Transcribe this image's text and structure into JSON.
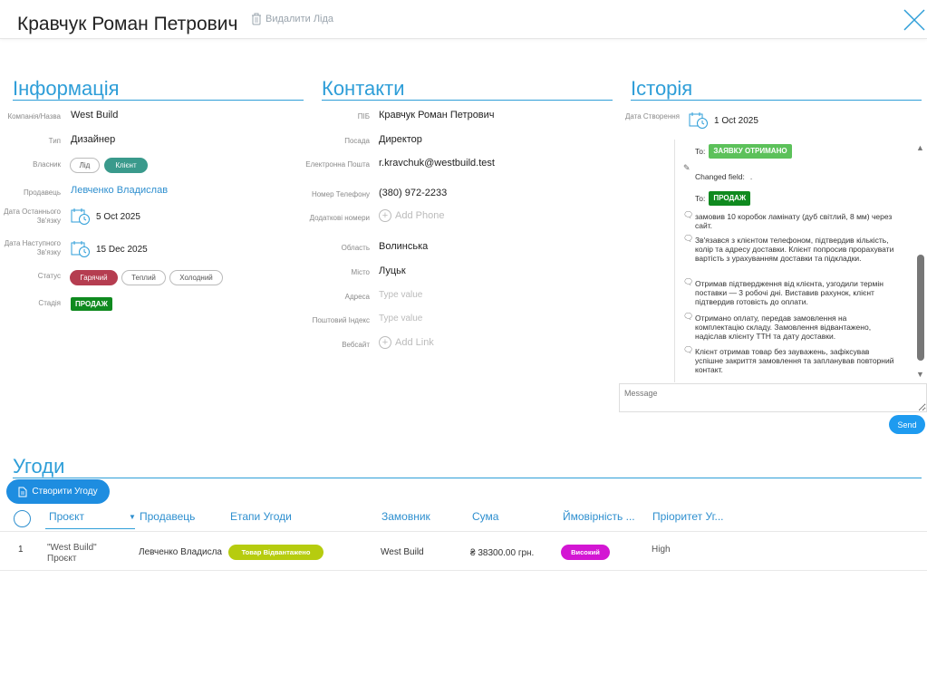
{
  "header": {
    "lead_name": "Кравчук Роман Петрович",
    "delete_label": "Видалити Ліда"
  },
  "info": {
    "title": "Інформація",
    "company_label": "Компанія/Назва",
    "company_value": "West Build",
    "type_label": "Тип",
    "type_value": "Дизайнер",
    "owner_label": "Власник",
    "owner_options": [
      "Лід",
      "Клієнт"
    ],
    "seller_label": "Продавець",
    "seller_value": "Левченко Владислав",
    "last_contact_label": "Дата Останнього Зв'язку",
    "last_contact_value": "5 Oct 2025",
    "next_contact_label": "Дата Наступного Зв'язку",
    "next_contact_value": "15 Dec 2025",
    "status_label": "Статус",
    "status_options": [
      "Гарячий",
      "Теплий",
      "Холодний"
    ],
    "stage_label": "Стадія",
    "stage_value": "ПРОДАЖ"
  },
  "contacts": {
    "title": "Контакти",
    "name_label": "ПІБ",
    "name_value": "Кравчук Роман Петрович",
    "position_label": "Посада",
    "position_value": "Директор",
    "email_label": "Електронна Пошта",
    "email_value": "r.kravchuk@westbuild.test",
    "phone_label": "Номер Телефону",
    "phone_value": "(380) 972-2233",
    "extra_label": "Додаткові номери",
    "add_phone": "Add Phone",
    "region_label": "Область",
    "region_value": "Волинська",
    "city_label": "Місто",
    "city_value": "Луцьк",
    "address_label": "Адреса",
    "address_placeholder": "Type value",
    "zip_label": "Поштовий Індекс",
    "zip_placeholder": "Type value",
    "website_label": "Вебсайт",
    "add_link": "Add Link"
  },
  "history": {
    "title": "Історія",
    "created_label": "Дата Створення",
    "created_value": "1 Oct 2025",
    "to_label_1": "To:",
    "tag_received": "ЗАЯВКУ ОТРИМАНО",
    "changed_field": "Changed field:",
    "changed_dot": ".",
    "to_label_2": "To:",
    "tag_sale": "ПРОДАЖ",
    "entries": [
      "замовив 10 коробок ламінату (дуб світлий, 8 мм) через сайт.",
      "Зв'язався з клієнтом телефоном, підтвердив кількість, колір та адресу доставки. Клієнт попросив прорахувати вартість з урахуванням доставки та підкладки.",
      "Отримав підтвердження від клієнта, узгодили термін поставки — 3 робочі дні. Виставив рахунок, клієнт підтвердив готовість до оплати.",
      "Отримано оплату, передав замовлення на комплектацію складу. Замовлення відвантажено, надіслав клієнту ТТН та дату доставки.",
      "Клієнт отримав товар без зауважень, зафіксував успішне закриття замовлення та запланував повторний контакт."
    ],
    "message_placeholder": "Message",
    "send_label": "Send"
  },
  "deals": {
    "title": "Угоди",
    "create_label": "Створити Угоду",
    "columns": [
      "Проєкт",
      "Продавець",
      "Етапи Угоди",
      "Замовник",
      "Сума",
      "Ймовірність ...",
      "Пріоритет Уг..."
    ],
    "rows": [
      {
        "num": "1",
        "project_line1": "\"West Build\"",
        "project_line2": "Проєкт",
        "seller": "Левченко Владисла",
        "stage": "Товар Відвантажено",
        "customer": "West Build",
        "amount": "₴ 38300.00 грн.",
        "probability": "Високий",
        "priority": "High"
      }
    ]
  },
  "colors": {
    "accent": "#2e9ed8",
    "button": "#1e8de0",
    "hot": "#b53d50",
    "client": "#3a9a8c",
    "sale_tag": "#0f8a1f",
    "stage_pill": "#b6cc0f",
    "prob_pill": "#d316d3"
  }
}
